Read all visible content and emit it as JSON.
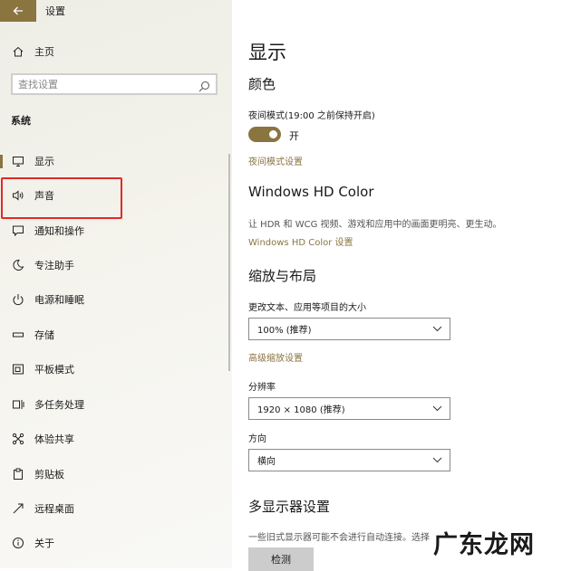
{
  "window": {
    "title": "设置"
  },
  "sidebar": {
    "home_label": "主页",
    "search_placeholder": "查找设置",
    "section_label": "系统",
    "items": [
      {
        "label": "显示",
        "icon": "monitor-icon"
      },
      {
        "label": "声音",
        "icon": "speaker-icon"
      },
      {
        "label": "通知和操作",
        "icon": "message-icon"
      },
      {
        "label": "专注助手",
        "icon": "moon-icon"
      },
      {
        "label": "电源和睡眠",
        "icon": "power-icon"
      },
      {
        "label": "存储",
        "icon": "storage-icon"
      },
      {
        "label": "平板模式",
        "icon": "tablet-icon"
      },
      {
        "label": "多任务处理",
        "icon": "multitask-icon"
      },
      {
        "label": "体验共享",
        "icon": "share-icon"
      },
      {
        "label": "剪贴板",
        "icon": "clipboard-icon"
      },
      {
        "label": "远程桌面",
        "icon": "remote-desktop-icon"
      },
      {
        "label": "关于",
        "icon": "info-icon"
      }
    ],
    "selected_index": 0
  },
  "main": {
    "title": "显示",
    "color_section": {
      "heading": "颜色",
      "night_light_label": "夜间模式(19:00 之前保持开启)",
      "toggle_state": "开",
      "night_light_link": "夜间模式设置"
    },
    "hdr_section": {
      "heading": "Windows HD Color",
      "description": "让 HDR 和 WCG 视频、游戏和应用中的画面更明亮、更生动。",
      "link": "Windows HD Color 设置"
    },
    "scale_section": {
      "heading": "缩放与布局",
      "scale_label": "更改文本、应用等项目的大小",
      "scale_value": "100% (推荐)",
      "advanced_link": "高级缩放设置",
      "resolution_label": "分辨率",
      "resolution_value": "1920 × 1080 (推荐)",
      "orientation_label": "方向",
      "orientation_value": "横向"
    },
    "multi_display": {
      "heading": "多显示器设置",
      "description": "一些旧式显示器可能不会进行自动连接。选择",
      "detect_button": "检测"
    }
  },
  "watermark": "广东龙网",
  "colors": {
    "accent": "#8a7440",
    "highlight_border": "#e02a2a"
  }
}
